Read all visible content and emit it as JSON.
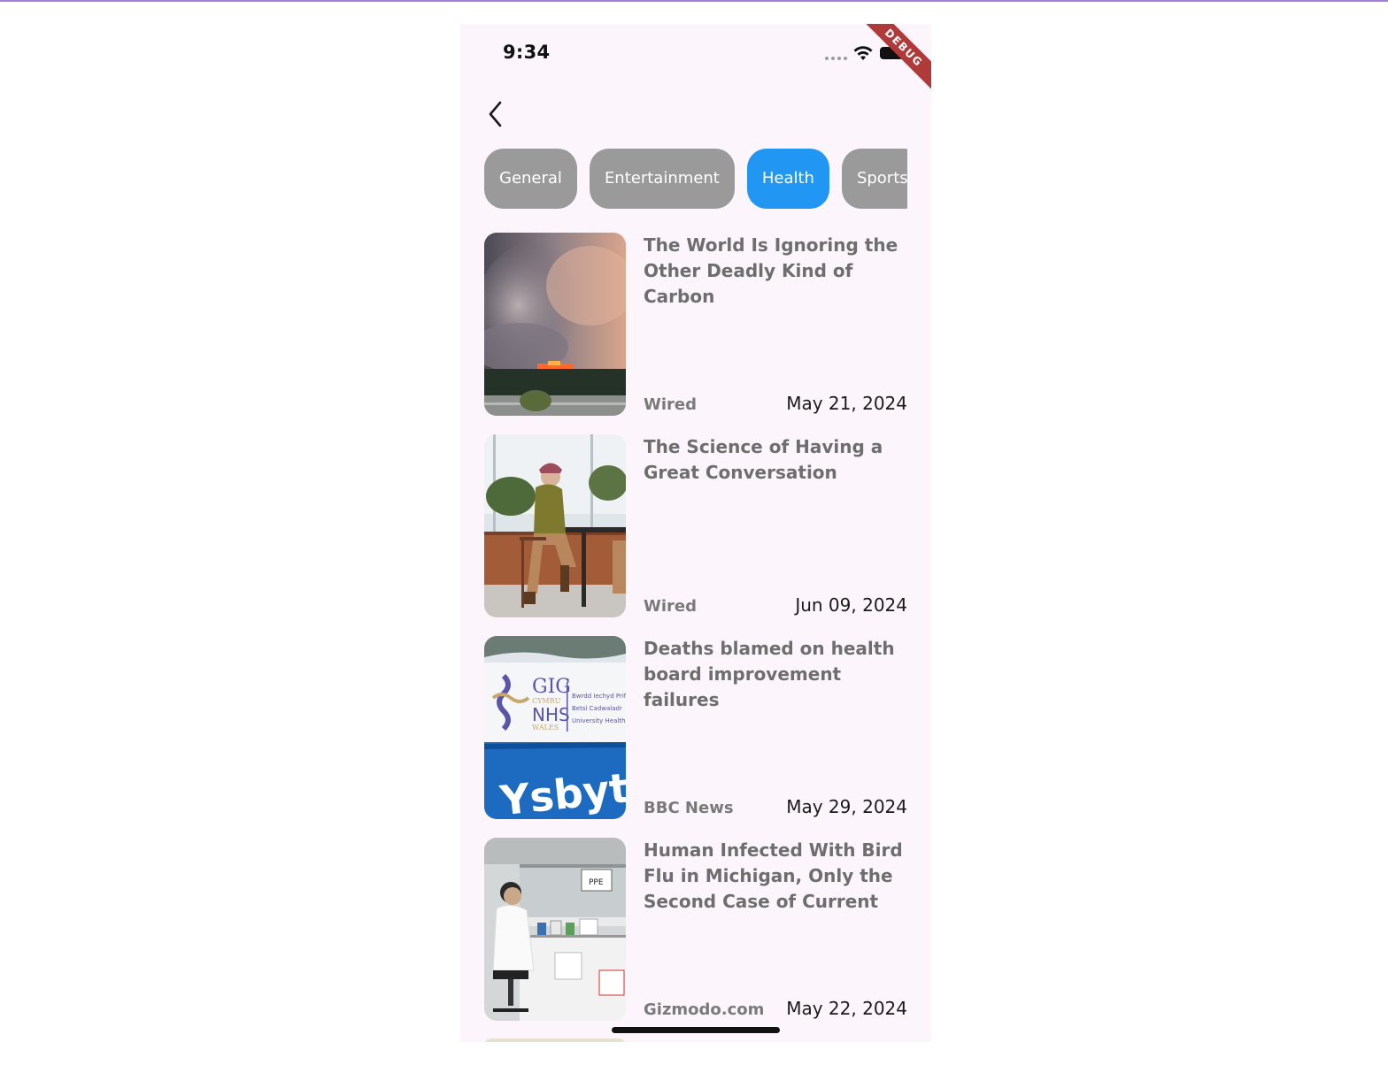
{
  "status_bar": {
    "time": "9:34"
  },
  "debug_banner": "DEBUG",
  "nav": {
    "back_icon": "chevron-left-icon"
  },
  "categories": [
    {
      "label": "General",
      "selected": false
    },
    {
      "label": "Entertainment",
      "selected": false
    },
    {
      "label": "Health",
      "selected": true
    },
    {
      "label": "Sports",
      "selected": false
    }
  ],
  "colors": {
    "chip": "#9a9a9a",
    "chip_active": "#2196f3",
    "background": "#fcf5fc"
  },
  "articles": [
    {
      "title": "The World Is Ignoring the Other Deadly Kind of Carbon",
      "source": "Wired",
      "date": "May 21, 2024"
    },
    {
      "title": "The Science of Having a Great Conversation",
      "source": "Wired",
      "date": "Jun 09, 2024"
    },
    {
      "title": "Deaths blamed on health board improvement failures",
      "source": "BBC News",
      "date": "May 29, 2024",
      "image_text": {
        "line1": "GIG",
        "line2": "CYMRU",
        "line3": "NHS",
        "line4": "WALES",
        "side": "Bwrdd Iechyd Prifysgol",
        "side2": "Betsi Cadwaladr",
        "side3": "University Health Board",
        "sign": "Ysbyty"
      }
    },
    {
      "title": "Human Infected With Bird Flu in Michigan, Only the Second Case of Current",
      "source": "Gizmodo.com",
      "date": "May 22, 2024",
      "image_text": {
        "label": "PPE"
      }
    }
  ]
}
